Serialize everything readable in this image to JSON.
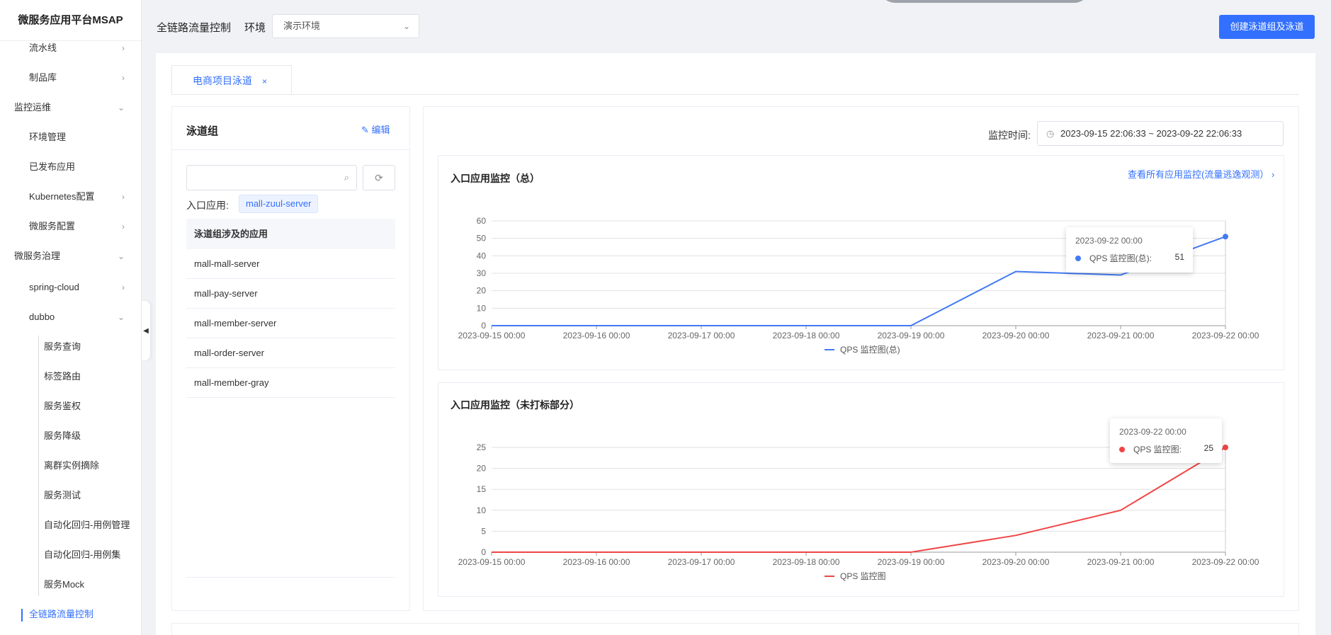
{
  "sidebar": {
    "title": "微服务应用平台MSAP",
    "items": [
      {
        "label": "流水线",
        "chev": "›"
      },
      {
        "label": "制品库",
        "chev": "›"
      },
      {
        "label": "监控运维",
        "chev": "⌄"
      },
      {
        "label": "环境管理",
        "chev": ""
      },
      {
        "label": "已发布应用",
        "chev": ""
      },
      {
        "label": "Kubernetes配置",
        "chev": "›"
      },
      {
        "label": "微服务配置",
        "chev": "›"
      },
      {
        "label": "微服务治理",
        "chev": "⌄"
      },
      {
        "label": "spring-cloud",
        "chev": "›"
      },
      {
        "label": "dubbo",
        "chev": "⌄"
      },
      {
        "label": "服务查询",
        "chev": ""
      },
      {
        "label": "标签路由",
        "chev": ""
      },
      {
        "label": "服务鉴权",
        "chev": ""
      },
      {
        "label": "服务降级",
        "chev": ""
      },
      {
        "label": "离群实例摘除",
        "chev": ""
      },
      {
        "label": "服务测试",
        "chev": ""
      },
      {
        "label": "自动化回归-用例管理",
        "chev": ""
      },
      {
        "label": "自动化回归-用例集",
        "chev": ""
      },
      {
        "label": "服务Mock",
        "chev": ""
      },
      {
        "label": "全链路流量控制",
        "chev": ""
      }
    ],
    "collapse_glyph": "◀"
  },
  "header": {
    "title": "全链路流量控制",
    "env_label": "环境",
    "env_value": "演示环境",
    "env_chevron": "⌄",
    "create_button": "创建泳道组及泳道"
  },
  "tab": {
    "label": "电商项目泳道",
    "close": "×"
  },
  "lane_group": {
    "title": "泳道组",
    "edit_icon": "✎",
    "edit": "编辑",
    "search_icon": "⌕",
    "search_placeholder": "",
    "refresh_icon": "⟳",
    "entry_label": "入口应用:",
    "entry_app": "mall-zuul-server",
    "table_header": "泳道组涉及的应用",
    "apps": [
      "mall-mall-server",
      "mall-pay-server",
      "mall-member-server",
      "mall-order-server",
      "mall-member-gray"
    ]
  },
  "monitor": {
    "time_label": "监控时间:",
    "clock_icon": "◷",
    "time_range": "2023-09-15 22:06:33 ~ 2023-09-22 22:06:33",
    "chart1": {
      "title": "入口应用监控（总）",
      "link": "查看所有应用监控(流量逃逸观测）",
      "link_chev": "›",
      "tooltip_time": "2023-09-22 00:00",
      "tooltip_name": "QPS 监控图(总):",
      "tooltip_value": "51",
      "color": "#4279f4"
    },
    "chart2": {
      "title": "入口应用监控（未打标部分）",
      "tooltip_time": "2023-09-22 00:00",
      "tooltip_name": "QPS 监控图:",
      "tooltip_value": "25",
      "color": "#f04545"
    }
  },
  "chart_data": [
    {
      "type": "line",
      "title": "入口应用监控（总）",
      "x": [
        "2023-09-15 00:00",
        "2023-09-16 00:00",
        "2023-09-17 00:00",
        "2023-09-18 00:00",
        "2023-09-19 00:00",
        "2023-09-20 00:00",
        "2023-09-21 00:00",
        "2023-09-22 00:00"
      ],
      "series": [
        {
          "name": "QPS 监控图(总)",
          "values": [
            0,
            0,
            0,
            0,
            0,
            31,
            29,
            51
          ]
        }
      ],
      "yticks": [
        "0",
        "10",
        "20",
        "30",
        "40",
        "50",
        "60"
      ],
      "ylim": [
        0,
        60
      ],
      "grid": true,
      "legend": "bottom"
    },
    {
      "type": "line",
      "title": "入口应用监控（未打标部分）",
      "x": [
        "2023-09-15 00:00",
        "2023-09-16 00:00",
        "2023-09-17 00:00",
        "2023-09-18 00:00",
        "2023-09-19 00:00",
        "2023-09-20 00:00",
        "2023-09-21 00:00",
        "2023-09-22 00:00"
      ],
      "series": [
        {
          "name": "QPS 监控图",
          "values": [
            0,
            0,
            0,
            0,
            0,
            4,
            10,
            25
          ]
        }
      ],
      "yticks": [
        "0",
        "5",
        "10",
        "15",
        "20",
        "25"
      ],
      "ylim": [
        0,
        25
      ],
      "grid": true,
      "legend": "bottom"
    }
  ]
}
